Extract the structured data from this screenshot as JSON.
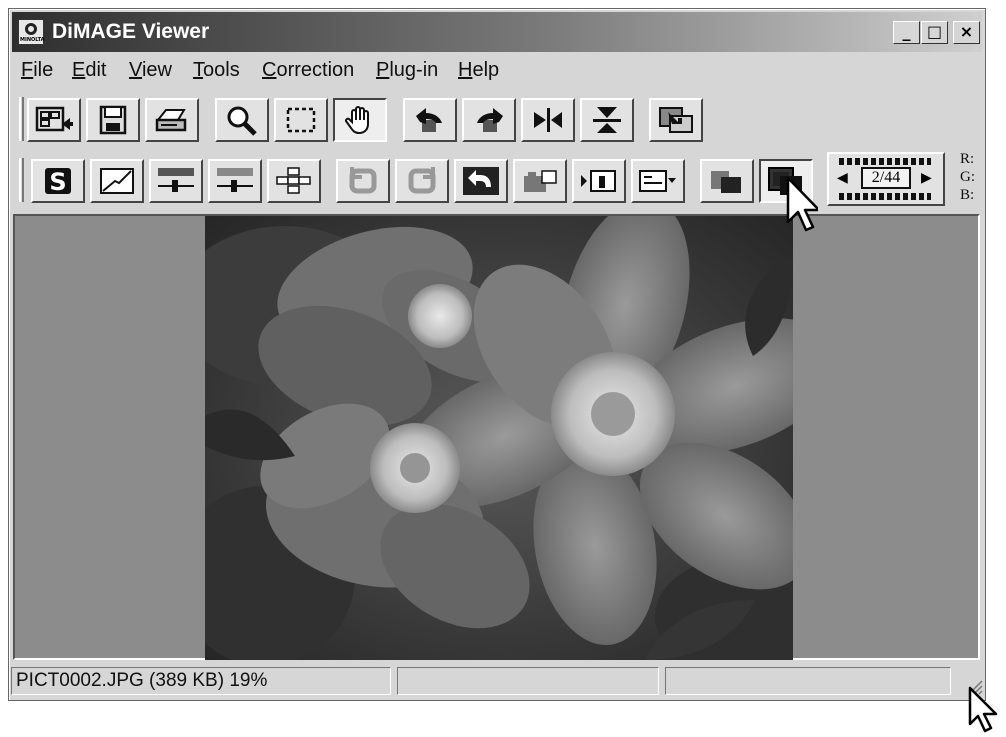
{
  "window": {
    "title": "DiMAGE Viewer",
    "controls": [
      "_",
      "□",
      "×"
    ]
  },
  "menu": [
    {
      "label": "File",
      "underline": "F",
      "rest": "ile"
    },
    {
      "label": "Edit",
      "underline": "E",
      "rest": "dit"
    },
    {
      "label": "View",
      "underline": "V",
      "rest": "iew"
    },
    {
      "label": "Tools",
      "underline": "T",
      "rest": "ools"
    },
    {
      "label": "Correction",
      "underline": "C",
      "rest": "orrection"
    },
    {
      "label": "Plug-in",
      "underline": "P",
      "rest": "lug-in"
    },
    {
      "label": "Help",
      "underline": "H",
      "rest": "elp"
    }
  ],
  "toolbar_main": [
    "thumbnail-view-icon",
    "save-icon",
    "print-icon",
    "zoom-icon",
    "select-icon",
    "hand-icon",
    "rotate-left-icon",
    "rotate-right-icon",
    "flip-horizontal-icon",
    "flip-vertical-icon",
    "save-corrected-icon"
  ],
  "toolbar_correction": [
    "color-space-icon",
    "tone-curve-icon",
    "brightness-contrast-icon",
    "hue-saturation-icon",
    "variation-icon",
    "undo-icon",
    "redo-icon",
    "undo-all-icon",
    "snapshot-icon",
    "pre-post-icon",
    "display-mode-icon",
    "compare-icon",
    "color-picker-icon"
  ],
  "navigator": {
    "counter": "2/44",
    "prev": "◀",
    "next": "▶"
  },
  "rgb_readout": {
    "r": "R:",
    "g": "G:",
    "b": "B:"
  },
  "status": {
    "file_info": "PICT0002.JPG (389 KB) 19%",
    "pane2": "",
    "pane3": ""
  }
}
